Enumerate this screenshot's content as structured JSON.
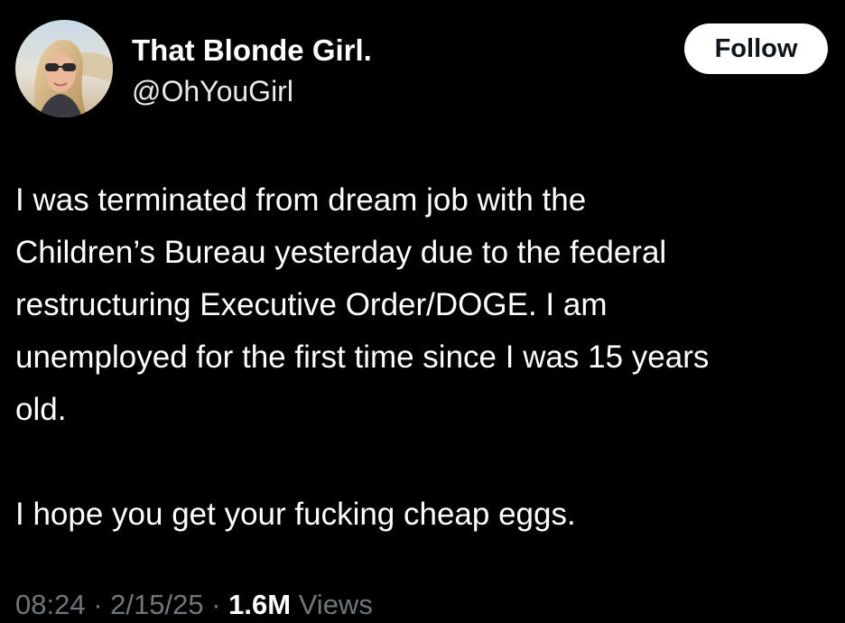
{
  "colors": {
    "background": "#000000",
    "text_primary": "#ffffff",
    "text_secondary": "#71767b",
    "follow_button_bg": "#ffffff",
    "follow_button_text": "#0f1419"
  },
  "author": {
    "display_name": "That Blonde Girl.",
    "handle": "@OhYouGirl",
    "avatar_icon": "profile-photo"
  },
  "follow_button": {
    "label": "Follow"
  },
  "tweet": {
    "lines": [
      "I was terminated from dream job with the",
      "Children’s Bureau yesterday due to the federal",
      "restructuring Executive Order/DOGE. I am",
      "unemployed for the first time since I was 15 years",
      "old.",
      "I hope you get your fucking cheap eggs."
    ]
  },
  "meta": {
    "time": "08:24",
    "date": "2/15/25",
    "separator": " · ",
    "views_count": "1.6M",
    "views_label": "Views"
  }
}
